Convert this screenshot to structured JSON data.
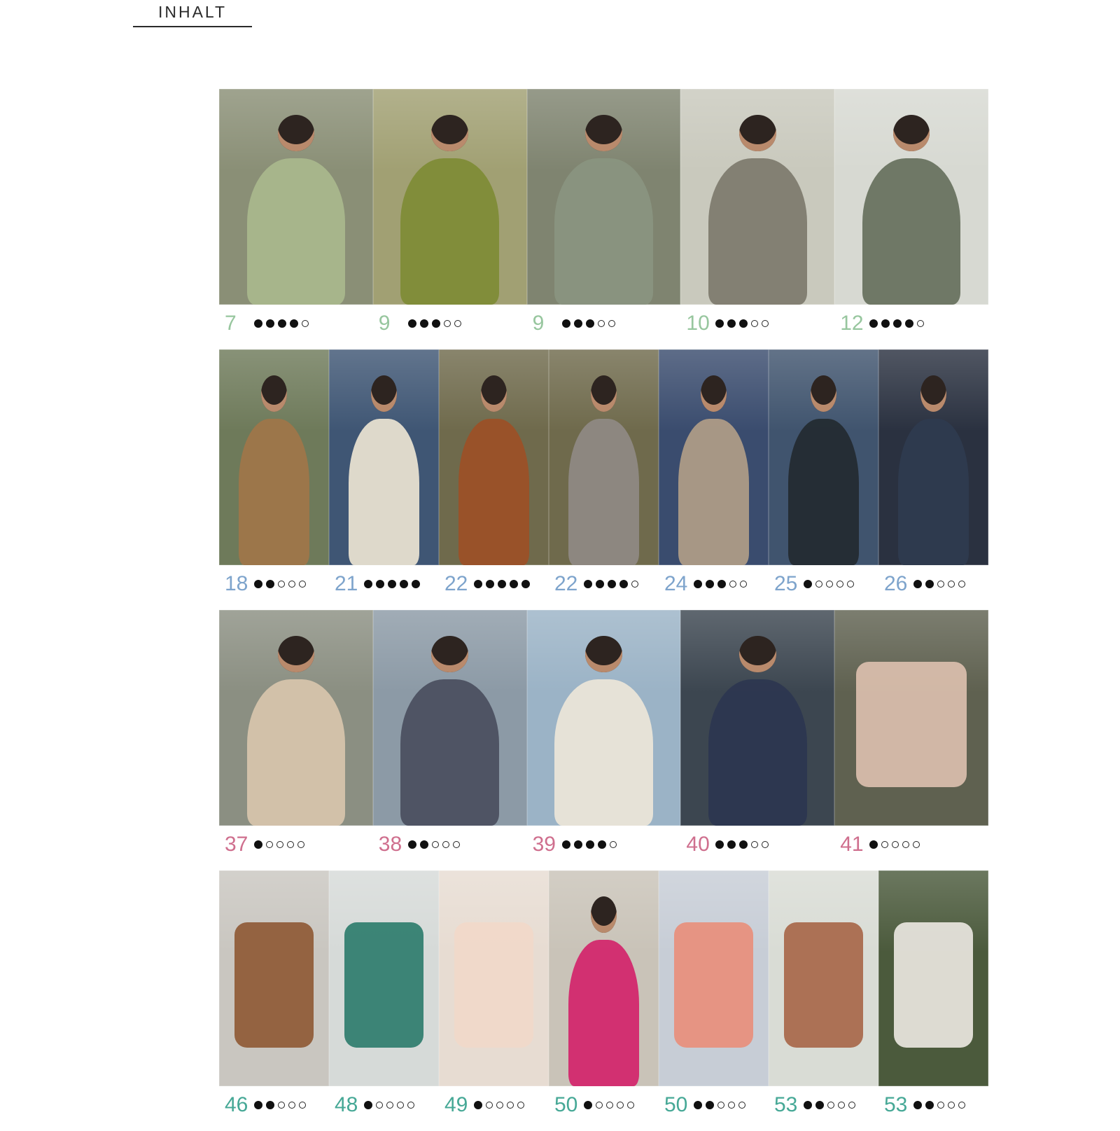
{
  "header": {
    "title": "INHALT"
  },
  "difficulty_max": 5,
  "rows": [
    {
      "row_color": "#97c69e",
      "items": [
        {
          "page": "7",
          "difficulty": 4,
          "image": "woman in sage cable-knit sweater in field",
          "colors": [
            "#8a8f76",
            "#a9b88d"
          ]
        },
        {
          "page": "9",
          "difficulty": 3,
          "image": "woman in olive green sweater with white belt",
          "colors": [
            "#a1a073",
            "#7e8b35"
          ]
        },
        {
          "page": "9",
          "difficulty": 3,
          "image": "close-up of woman in grey-green cardigan among grass",
          "colors": [
            "#7f8470",
            "#8a9580"
          ]
        },
        {
          "page": "10",
          "difficulty": 3,
          "image": "woman in grey striped jacket with green flower",
          "colors": [
            "#c9c9bd",
            "#7d7a6c"
          ]
        },
        {
          "page": "12",
          "difficulty": 4,
          "image": "woman in long grey-green cardigan and green skirt",
          "colors": [
            "#d7d9d2",
            "#66705c"
          ]
        }
      ]
    },
    {
      "row_color": "#7ea4cc",
      "items": [
        {
          "page": "18",
          "difficulty": 2,
          "image": "couple, woman in knitted vest with patchwork scarf",
          "colors": [
            "#6e7a5a",
            "#a07549"
          ]
        },
        {
          "page": "21",
          "difficulty": 5,
          "image": "woman in cream cable cardigan sitting",
          "colors": [
            "#3f5674",
            "#ece4d2"
          ]
        },
        {
          "page": "22",
          "difficulty": 5,
          "image": "man in rust turtleneck sweater walking",
          "colors": [
            "#6f6a4c",
            "#9c5026"
          ]
        },
        {
          "page": "22",
          "difficulty": 4,
          "image": "woman in grey long cardigan walking",
          "colors": [
            "#6f6a4c",
            "#8f8a84"
          ]
        },
        {
          "page": "24",
          "difficulty": 3,
          "image": "woman in beige bucket hat and mittens",
          "colors": [
            "#3a4c6e",
            "#b19d87"
          ]
        },
        {
          "page": "25",
          "difficulty": 1,
          "image": "man with black knitted snood scarf",
          "colors": [
            "#40546e",
            "#232a30"
          ]
        },
        {
          "page": "26",
          "difficulty": 2,
          "image": "man in navy knitted cardigan",
          "colors": [
            "#2a3140",
            "#2f3b4f"
          ]
        }
      ]
    },
    {
      "row_color": "#cf6f8e",
      "items": [
        {
          "page": "37",
          "difficulty": 1,
          "image": "woman in beige long mohair cardigan by the shore",
          "colors": [
            "#8b8f82",
            "#d8c6ad"
          ]
        },
        {
          "page": "38",
          "difficulty": 2,
          "image": "woman in grey lace sweater with black coat and cap",
          "colors": [
            "#8c9aa6",
            "#4a4e5e"
          ]
        },
        {
          "page": "39",
          "difficulty": 4,
          "image": "woman in cream textured sweater with green trim",
          "colors": [
            "#9bb3c6",
            "#ede6d8"
          ]
        },
        {
          "page": "40",
          "difficulty": 3,
          "image": "woman in navy cardigan on a boat",
          "colors": [
            "#3c4650",
            "#2c3650"
          ]
        },
        {
          "page": "41",
          "difficulty": 1,
          "image": "pale pink ribbed beanie on tree stump",
          "colors": [
            "#5f6150",
            "#dbbfae"
          ],
          "object": true
        }
      ]
    },
    {
      "row_color": "#46a896",
      "items": [
        {
          "page": "46",
          "difficulty": 2,
          "image": "striped knitted Christmas stockings with tinsel",
          "colors": [
            "#c9c6c0",
            "#8f5a36"
          ],
          "object": true
        },
        {
          "page": "48",
          "difficulty": 1,
          "image": "crocheted coasters and white vases",
          "colors": [
            "#d6dad8",
            "#2f7d6e"
          ],
          "object": true
        },
        {
          "page": "49",
          "difficulty": 1,
          "image": "pale pink ribbed cushions",
          "colors": [
            "#e7dcd2",
            "#f1d8c9"
          ],
          "object": true
        },
        {
          "page": "50",
          "difficulty": 1,
          "image": "woman with pink hand muff bag",
          "colors": [
            "#c9c3b8",
            "#d2246a"
          ]
        },
        {
          "page": "50",
          "difficulty": 2,
          "image": "chunky knit mittens in salmon and blue",
          "colors": [
            "#c7cdd6",
            "#e88f7c"
          ],
          "object": true
        },
        {
          "page": "53",
          "difficulty": 2,
          "image": "crocheted Christmas tree ornaments",
          "colors": [
            "#d9dcd5",
            "#a8674a"
          ],
          "object": true
        },
        {
          "page": "53",
          "difficulty": 2,
          "image": "crocheted star with Santa face",
          "colors": [
            "#4b5a3c",
            "#e9e6df"
          ],
          "object": true
        }
      ]
    }
  ]
}
